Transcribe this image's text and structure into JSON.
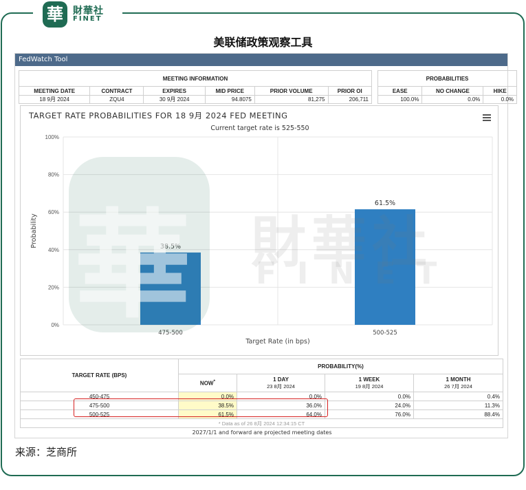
{
  "brand": {
    "seal_char": "華",
    "name_cn": "財華社",
    "name_en": "FINET",
    "accent": "#1f6b53"
  },
  "title": "美联储政策观察工具",
  "panel": {
    "header": "FedWatch Tool"
  },
  "meeting_info": {
    "group_label": "MEETING INFORMATION",
    "columns": [
      "MEETING DATE",
      "CONTRACT",
      "EXPIRES",
      "MID PRICE",
      "PRIOR VOLUME",
      "PRIOR OI"
    ],
    "row": [
      "18 9月 2024",
      "ZQU4",
      "30 9月 2024",
      "94.8075",
      "81,275",
      "206,711"
    ]
  },
  "probabilities": {
    "group_label": "PROBABILITIES",
    "columns": [
      "EASE",
      "NO CHANGE",
      "HIKE"
    ],
    "row": [
      "100.0%",
      "0.0%",
      "0.0%"
    ]
  },
  "chart_data": {
    "type": "bar",
    "title": "TARGET RATE PROBABILITIES FOR 18 9月 2024 FED MEETING",
    "subtitle": "Current target rate is 525-550",
    "categories": [
      "475-500",
      "500-525"
    ],
    "values": [
      38.5,
      61.5
    ],
    "data_labels": [
      "38.5%",
      "61.5%"
    ],
    "xlabel": "Target Rate (in bps)",
    "ylabel": "Probability",
    "ylim": [
      0,
      100
    ],
    "yticks": [
      "0%",
      "20%",
      "40%",
      "60%",
      "80%",
      "100%"
    ],
    "bar_color": "#2f7fc1",
    "grid": true
  },
  "rate_table": {
    "target_header": "TARGET RATE (BPS)",
    "prob_header": "PROBABILITY(%)",
    "cols": [
      {
        "label": "NOW",
        "mark": "*",
        "date": ""
      },
      {
        "label": "1 DAY",
        "mark": "",
        "date": "23 8月 2024"
      },
      {
        "label": "1 WEEK",
        "mark": "",
        "date": "19 8月 2024"
      },
      {
        "label": "1 MONTH",
        "mark": "",
        "date": "26 7月 2024"
      }
    ],
    "rows": [
      [
        "450-475",
        "0.0%",
        "0.0%",
        "0.0%",
        "0.4%"
      ],
      [
        "475-500",
        "38.5%",
        "36.0%",
        "24.0%",
        "11.3%"
      ],
      [
        "500-525",
        "61.5%",
        "64.0%",
        "76.0%",
        "88.4%"
      ]
    ],
    "data_note": "* Data as of 26 8月 2024 12:34:15 CT",
    "projection_note": "2027/1/1 and forward are projected meeting dates"
  },
  "source": "来源：芝商所"
}
